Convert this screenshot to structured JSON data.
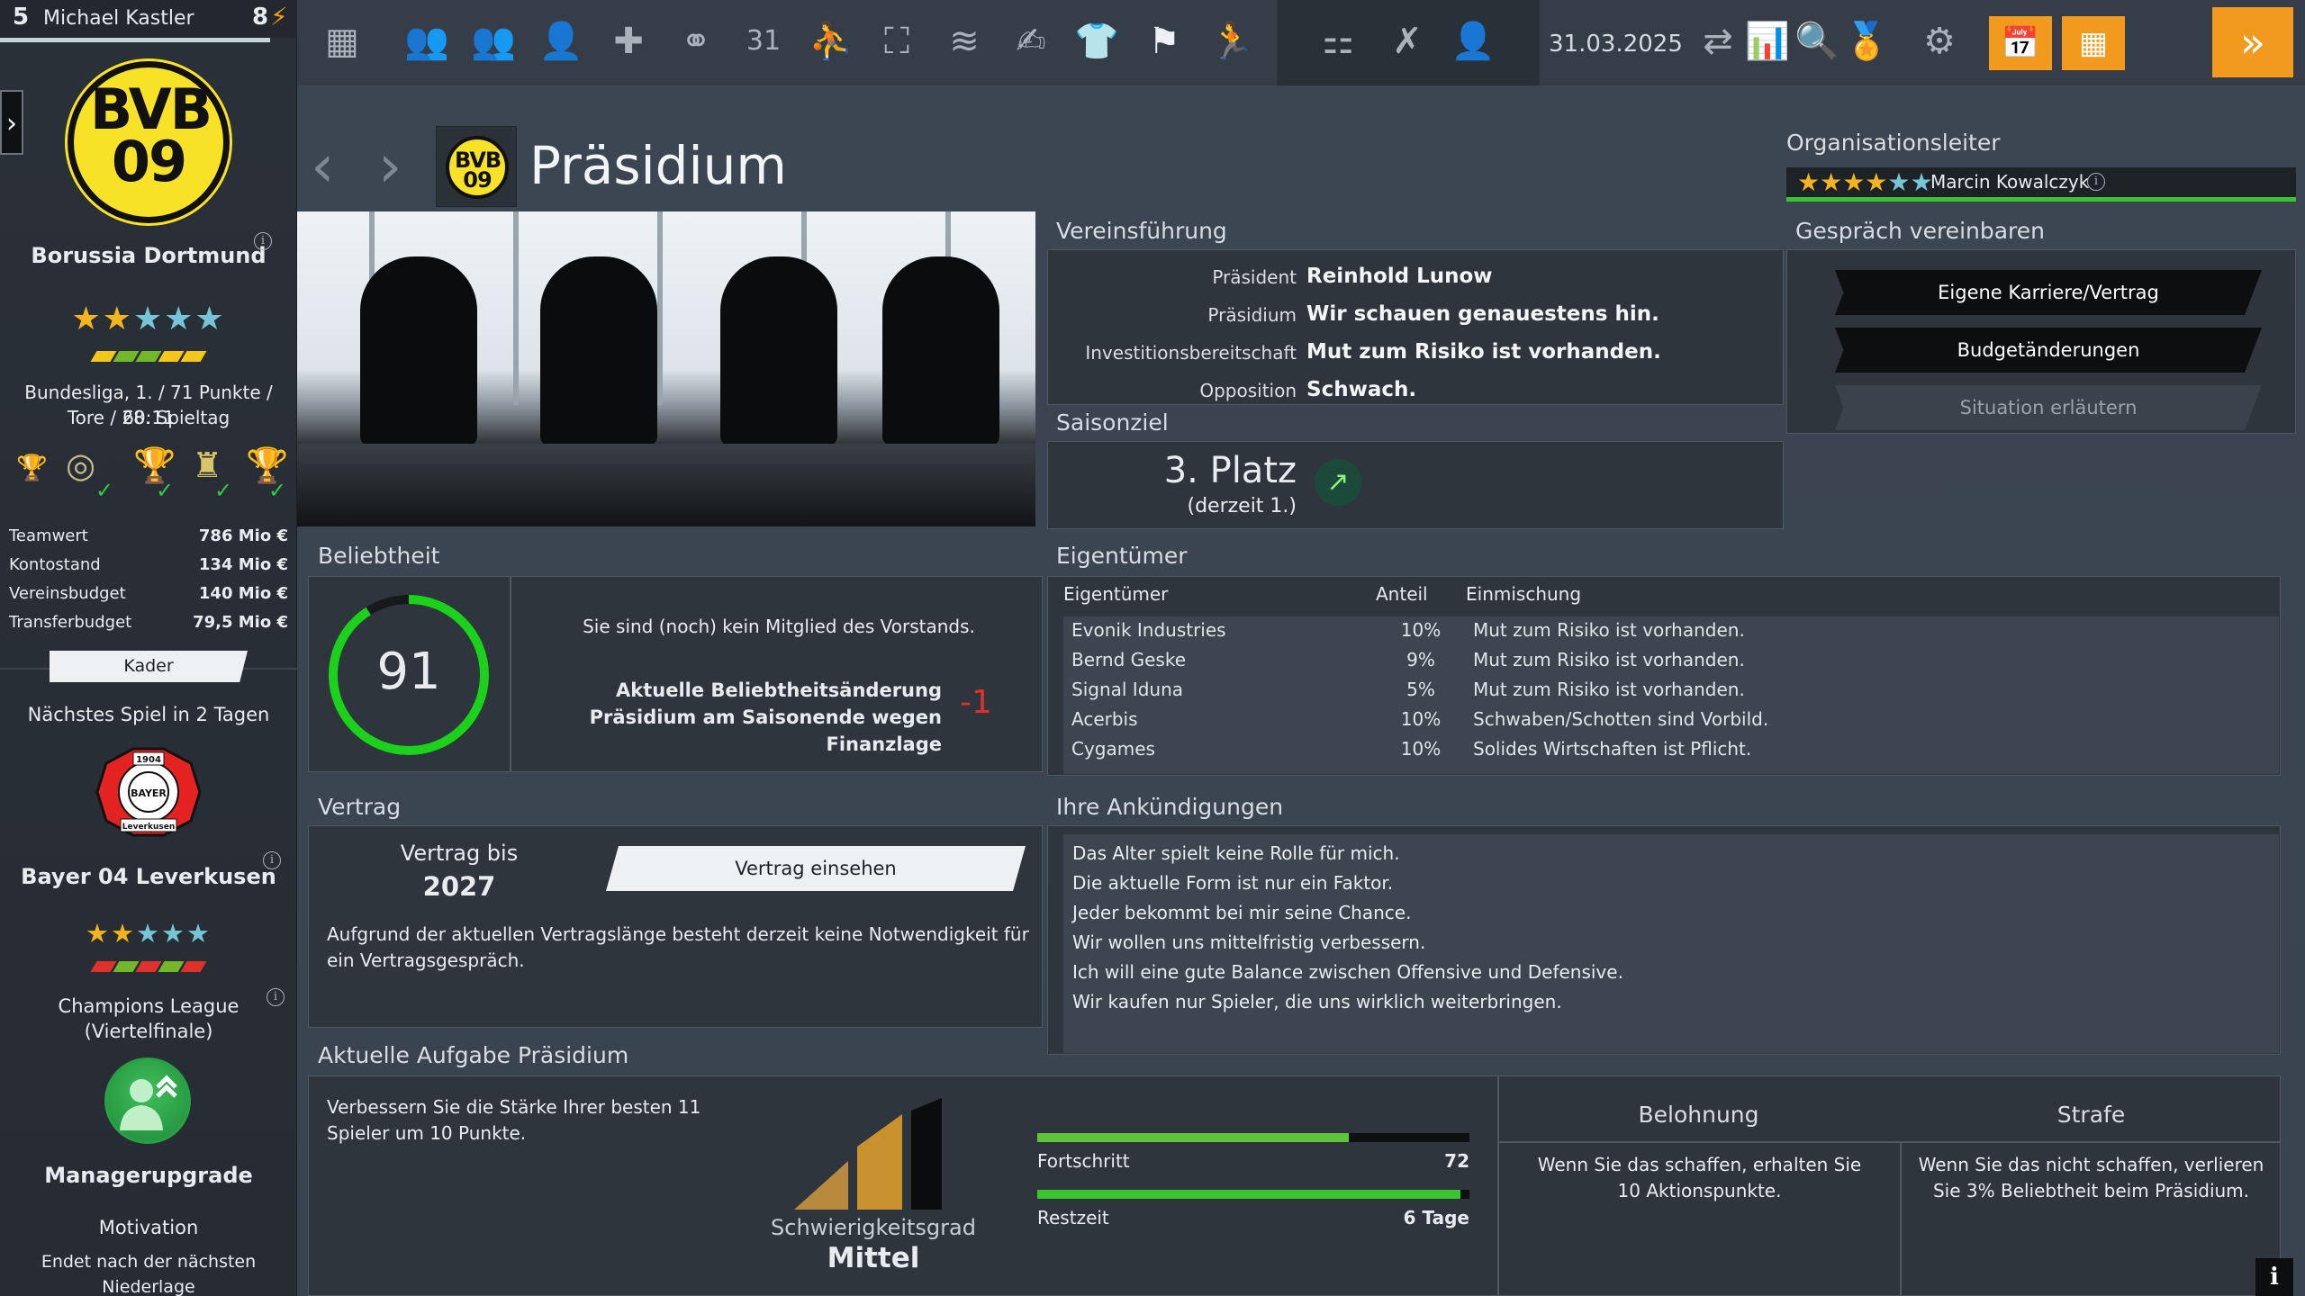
{
  "sidebar": {
    "player_number": "5",
    "manager_name": "Michael Kastler",
    "level": "8",
    "club": {
      "crest_text": "BVB 09",
      "name": "Borussia Dortmund",
      "stars_filled": 2,
      "stars_total": 5,
      "league_line1": "Bundesliga, 1. / 71 Punkte / 60:11",
      "league_line2": "Tore / 28. Spieltag"
    },
    "finance": [
      {
        "label": "Teamwert",
        "value": "786 Mio €"
      },
      {
        "label": "Kontostand",
        "value": "134 Mio €"
      },
      {
        "label": "Vereinsbudget",
        "value": "140 Mio €"
      },
      {
        "label": "Transferbudget",
        "value": "79,5 Mio €"
      }
    ],
    "kader_label": "Kader",
    "next_game": "Nächstes Spiel in 2 Tagen",
    "opponent": {
      "name": "Bayer 04 Leverkusen",
      "crest_text": "BAYER",
      "crest_year": "1904",
      "crest_bottom": "Leverkusen",
      "stars_filled": 2,
      "stars_total": 5,
      "competition": "Champions League (Viertelfinale)"
    },
    "upgrade": {
      "title": "Managerupgrade",
      "subtitle": "Motivation",
      "note": "Endet nach der nächsten Niederlage"
    }
  },
  "topbar": {
    "date": "31.03.2025",
    "calendar_day": "31",
    "orange_btn1_day": "7"
  },
  "page": {
    "title": "Präsidium",
    "crest_text": "BVB 09"
  },
  "organisationsleiter": {
    "label": "Organisationsleiter",
    "stars_filled": 4,
    "stars_total": 6,
    "name": "Marcin Kowalczyk"
  },
  "vereinsfuehrung": {
    "title": "Vereinsführung",
    "rows": [
      {
        "label": "Präsident",
        "value": "Reinhold Lunow"
      },
      {
        "label": "Präsidium",
        "value": "Wir schauen genauestens hin."
      },
      {
        "label": "Investitionsbereitschaft",
        "value": "Mut zum Risiko ist vorhanden."
      },
      {
        "label": "Opposition",
        "value": "Schwach."
      }
    ]
  },
  "gespraech": {
    "title": "Gespräch vereinbaren",
    "buttons": [
      "Eigene Karriere/Vertrag",
      "Budgetänderungen",
      "Situation erläutern"
    ]
  },
  "saisonziel": {
    "title": "Saisonziel",
    "goal": "3. Platz",
    "current": "(derzeit 1.)"
  },
  "beliebtheit": {
    "title": "Beliebtheit",
    "value": "91",
    "percent": 91,
    "note": "Sie sind (noch) kein Mitglied des Vorstands.",
    "change_text": "Aktuelle Beliebtheitsänderung Präsidium am Saisonende wegen Finanzlage",
    "change_value": "-1"
  },
  "eigentuemer": {
    "title": "Eigentümer",
    "headers": [
      "Eigentümer",
      "Anteil",
      "Einmischung"
    ],
    "rows": [
      {
        "name": "Evonik Industries",
        "share": "10%",
        "mix": "Mut zum Risiko ist vorhanden."
      },
      {
        "name": "Bernd Geske",
        "share": "9%",
        "mix": "Mut zum Risiko ist vorhanden."
      },
      {
        "name": "Signal Iduna",
        "share": "5%",
        "mix": "Mut zum Risiko ist vorhanden."
      },
      {
        "name": "Acerbis",
        "share": "10%",
        "mix": "Schwaben/Schotten sind Vorbild."
      },
      {
        "name": "Cygames",
        "share": "10%",
        "mix": "Solides Wirtschaften ist Pflicht."
      }
    ]
  },
  "vertrag": {
    "title": "Vertrag",
    "label": "Vertrag bis",
    "year": "2027",
    "button": "Vertrag einsehen",
    "note": "Aufgrund der aktuellen Vertragslänge besteht derzeit keine Notwendigkeit für ein Vertragsgespräch."
  },
  "ankuendigungen": {
    "title": "Ihre Ankündigungen",
    "items": [
      "Das Alter spielt keine Rolle für mich.",
      "Die aktuelle Form ist nur ein Faktor.",
      "Jeder bekommt bei mir seine Chance.",
      "Wir wollen uns mittelfristig verbessern.",
      "Ich will eine gute Balance zwischen Offensive und Defensive.",
      "Wir kaufen nur Spieler, die uns wirklich weiterbringen."
    ]
  },
  "aufgabe": {
    "title": "Aktuelle Aufgabe Präsidium",
    "description": "Verbessern Sie die Stärke Ihrer besten 11 Spieler um 10 Punkte.",
    "difficulty_label": "Schwierigkeitsgrad",
    "difficulty": "Mittel",
    "fortschritt_label": "Fortschritt",
    "fortschritt_value": "72",
    "fortschritt_fraction": 0.72,
    "restzeit_label": "Restzeit",
    "restzeit_value": "6 Tage",
    "restzeit_fraction": 0.98,
    "belohnung_title": "Belohnung",
    "belohnung_text": "Wenn Sie das schaffen, erhalten Sie 10 Aktionspunkte.",
    "strafe_title": "Strafe",
    "strafe_text": "Wenn Sie das nicht schaffen, verlieren Sie 3% Beliebtheit beim Präsidium."
  },
  "colors": {
    "accent_orange": "#f29a1e",
    "gauge_green": "#1bd11b",
    "bvb_yellow": "#f8e227",
    "star_gold": "#f3b41d",
    "star_empty": "#75c5d7",
    "negative_red": "#e0322c"
  }
}
